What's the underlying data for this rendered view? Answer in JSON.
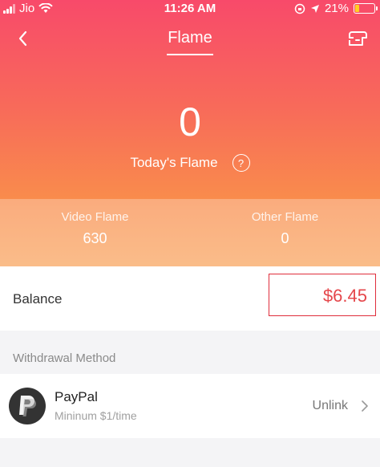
{
  "status_bar": {
    "carrier": "Jio",
    "time": "11:26 AM",
    "battery": "21%"
  },
  "nav": {
    "title": "Flame",
    "back_icon": "chevron-left-icon",
    "right_icon": "receipt-icon"
  },
  "flame": {
    "today_value": "0",
    "today_label": "Today's Flame",
    "help_glyph": "?",
    "video_label": "Video Flame",
    "video_value": "630",
    "other_label": "Other Flame",
    "other_value": "0"
  },
  "balance": {
    "label": "Balance",
    "value": "$6.45",
    "highlight_color": "#e02e3c"
  },
  "withdrawal": {
    "section_title": "Withdrawal Method",
    "methods": [
      {
        "name": "PayPal",
        "subtitle": "Mininum $1/time",
        "action": "Unlink",
        "icon": "paypal-icon"
      }
    ]
  },
  "colors": {
    "gradient_top": "#f84a6a",
    "gradient_bottom": "#f9a35c",
    "value_red": "#e5474b"
  }
}
